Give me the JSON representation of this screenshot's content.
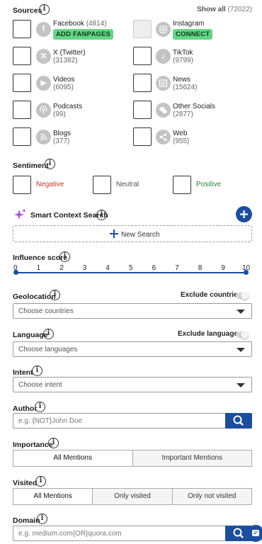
{
  "sources": {
    "title": "Sources",
    "show_all": "Show all",
    "show_all_count": "(72022)",
    "items": [
      {
        "name": "Facebook",
        "count": "(4814)",
        "badge": "ADD FANPAGES",
        "icon": "facebook-icon"
      },
      {
        "name": "Instagram",
        "count": "",
        "badge": "CONNECT",
        "icon": "instagram-icon"
      },
      {
        "name": "X (Twitter)",
        "count": "(31382)",
        "icon": "x-twitter-icon"
      },
      {
        "name": "TikTok",
        "count": "(9799)",
        "icon": "tiktok-icon"
      },
      {
        "name": "Videos",
        "count": "(6095)",
        "icon": "video-play-icon"
      },
      {
        "name": "News",
        "count": "(15624)",
        "icon": "news-icon"
      },
      {
        "name": "Podcasts",
        "count": "(99)",
        "icon": "podcast-icon"
      },
      {
        "name": "Other Socials",
        "count": "(2877)",
        "icon": "chat-bubbles-icon"
      },
      {
        "name": "Blogs",
        "count": "(377)",
        "icon": "rss-icon"
      },
      {
        "name": "Web",
        "count": "(955)",
        "icon": "share-icon"
      }
    ]
  },
  "sentiment": {
    "title": "Sentiment",
    "negative": "Negative",
    "neutral": "Neutral",
    "positive": "Positive",
    "colors": {
      "negative": "#c0392b",
      "neutral": "#555555",
      "positive": "#2e7d32"
    }
  },
  "smart_context": {
    "title": "Smart Context Search",
    "new_search": "New Search",
    "accent": "#1c4e9f"
  },
  "influence": {
    "title": "Influence score",
    "ticks": [
      "0",
      "1",
      "2",
      "3",
      "4",
      "5",
      "6",
      "7",
      "8",
      "9",
      "10"
    ],
    "range": [
      0,
      10
    ]
  },
  "geolocation": {
    "title": "Geolocation",
    "toggle_label": "Exclude countries",
    "placeholder": "Choose countries"
  },
  "language": {
    "title": "Language",
    "toggle_label": "Exclude languages",
    "placeholder": "Choose languages"
  },
  "intent": {
    "title": "Intent",
    "placeholder": "Choose intent"
  },
  "author": {
    "title": "Author",
    "placeholder": "e.g. {NOT}John Doe"
  },
  "importance": {
    "title": "Importance",
    "options": [
      "All Mentions",
      "Important Mentions"
    ]
  },
  "visited": {
    "title": "Visited",
    "options": [
      "All Mentions",
      "Only visited",
      "Only not visited"
    ]
  },
  "domain": {
    "title": "Domain",
    "placeholder": "e.g. medium.com{OR}quora.com"
  }
}
